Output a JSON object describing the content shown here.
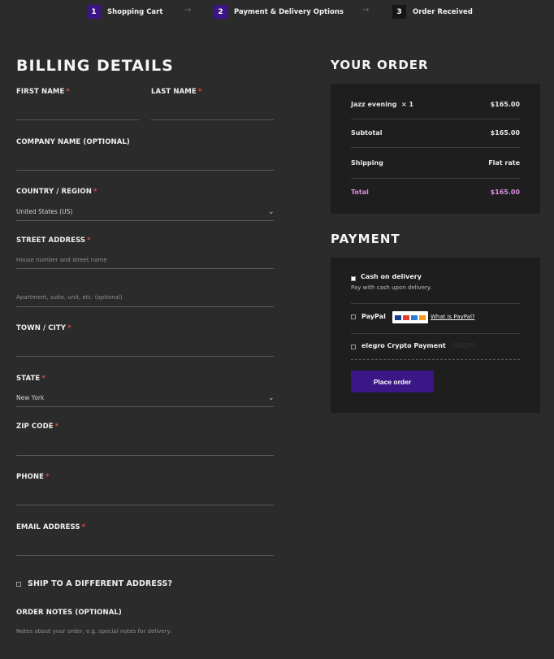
{
  "steps": [
    {
      "num": "1",
      "label": "Shopping Cart"
    },
    {
      "num": "2",
      "label": "Payment & Delivery Options"
    },
    {
      "num": "3",
      "label": "Order Received"
    }
  ],
  "billing": {
    "title": "BILLING DETAILS",
    "first_name": "FIRST NAME",
    "last_name": "LAST NAME",
    "company": "COMPANY NAME (OPTIONAL)",
    "country_label": "COUNTRY / REGION",
    "country_value": "United States (US)",
    "street_label": "STREET ADDRESS",
    "street_placeholder": "House number and street name",
    "apt_placeholder": "Apartment, suite, unit, etc. (optional)",
    "town_label": "TOWN / CITY",
    "state_label": "STATE",
    "state_value": "New York",
    "zip_label": "ZIP CODE",
    "phone_label": "PHONE",
    "email_label": "EMAIL ADDRESS",
    "ship_different": "SHIP TO A DIFFERENT ADDRESS?",
    "notes_label": "ORDER NOTES (OPTIONAL)",
    "notes_placeholder": "Notes about your order, e.g. special notes for delivery.",
    "required_mark": "*"
  },
  "order": {
    "title": "YOUR ORDER",
    "item_name": "Jazz evening",
    "item_qty": "× 1",
    "item_price": "$165.00",
    "subtotal_label": "Subtotal",
    "subtotal_value": "$165.00",
    "shipping_label": "Shipping",
    "shipping_value": "Flat rate",
    "total_label": "Total",
    "total_value": "$165.00"
  },
  "payment": {
    "title": "PAYMENT",
    "cod_label": "Cash on delivery",
    "cod_desc": "Pay with cash upon delivery.",
    "paypal_label": "PayPal",
    "paypal_link": "What is PayPal?",
    "crypto_label": "elegro Crypto Payment",
    "crypto_logo_text": "elegro",
    "place_order": "Place order"
  },
  "icons": {
    "step_arrow": "arrow-right-icon",
    "select_chevron": "chevron-down-icon",
    "card_logos": "card-logos-icon"
  },
  "colors": {
    "accent": "#3b1585",
    "required": "#e0473f",
    "total": "#d98ed9",
    "panel": "#1e1e1f",
    "background": "#2b2b2b"
  }
}
